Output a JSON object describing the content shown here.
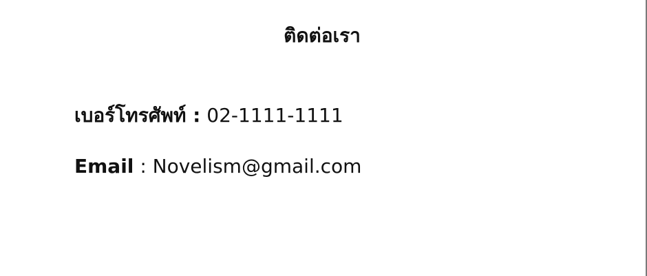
{
  "page": {
    "title": "ติดต่อเรา"
  },
  "contact": {
    "phone_label": "เบอร์โทรศัพท์ :",
    "phone_value": "02-1111-1111",
    "email_label": "Email",
    "email_separator": ":",
    "email_value": "Novelism@gmail.com"
  }
}
